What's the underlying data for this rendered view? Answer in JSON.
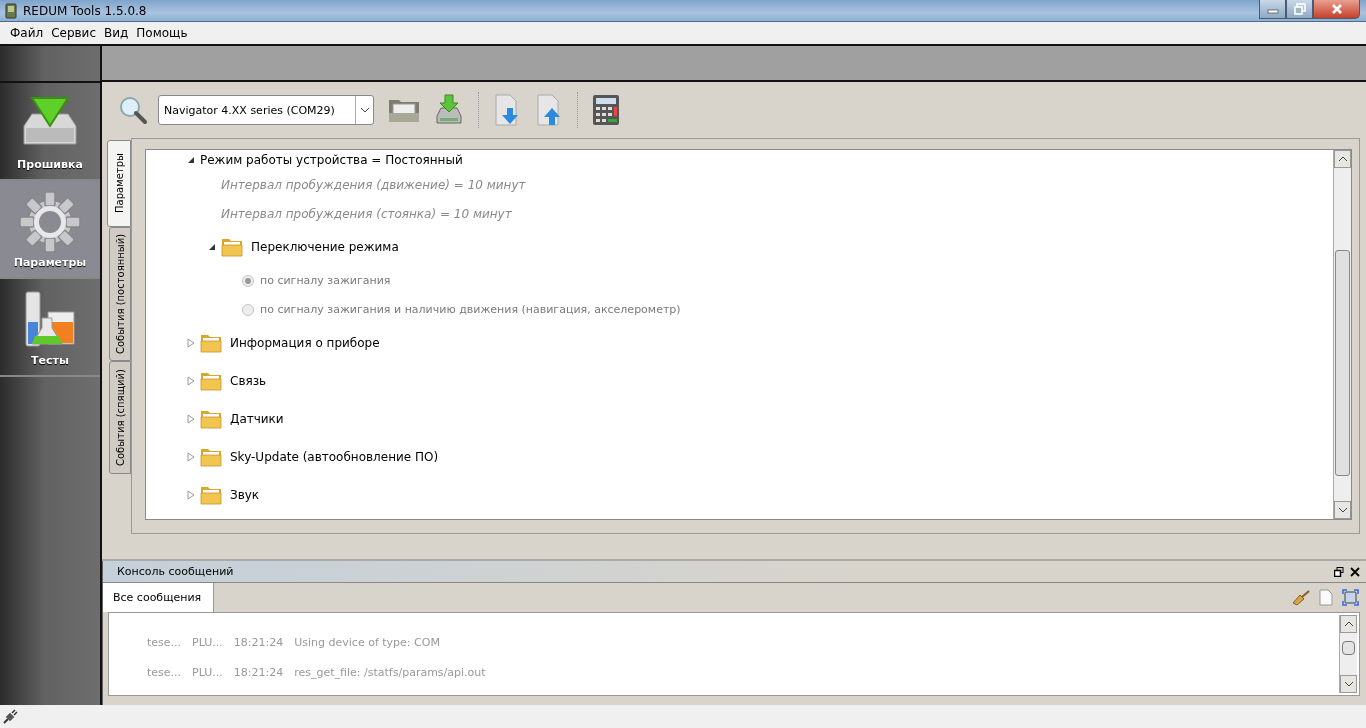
{
  "window": {
    "title": "REDUM Tools 1.5.0.8"
  },
  "menu": [
    "Файл",
    "Сервис",
    "Вид",
    "Помощь"
  ],
  "sidebar": {
    "items": [
      {
        "kind": "firmware",
        "label": "Прошивка",
        "selected": false
      },
      {
        "kind": "settings",
        "label": "Параметры",
        "selected": true
      },
      {
        "kind": "tests",
        "label": "Тесты",
        "selected": false
      }
    ]
  },
  "toolbar": {
    "device_select": {
      "value": "Navigator 4.XX series (COM29)"
    }
  },
  "tabs": [
    {
      "label": "Параметры",
      "selected": true
    },
    {
      "label": "События (постоянный)",
      "selected": false
    },
    {
      "label": "События (спящий)",
      "selected": false
    }
  ],
  "tree": [
    {
      "kind": "setting",
      "label": "Режим работы устройства = Постоянный",
      "expanded": true,
      "children": [
        {
          "kind": "param",
          "label": "Интервал пробуждения (движение) = 10 минут",
          "disabled": true
        },
        {
          "kind": "param",
          "label": "Интервал пробуждения (стоянка) = 10 минут",
          "disabled": true
        },
        {
          "kind": "folder",
          "label": "Переключение режима",
          "expanded": true,
          "children": [
            {
              "kind": "radio",
              "label": "по сигналу зажигания",
              "selected": true,
              "disabled": true
            },
            {
              "kind": "radio",
              "label": "по сигналу зажигания и наличию движения (навигация, акселерометр)",
              "selected": false,
              "disabled": true
            }
          ]
        }
      ]
    },
    {
      "kind": "folder",
      "label": "Информация о приборе",
      "expanded": false
    },
    {
      "kind": "folder",
      "label": "Связь",
      "expanded": false
    },
    {
      "kind": "folder",
      "label": "Датчики",
      "expanded": false
    },
    {
      "kind": "folder",
      "label": "Sky-Update (автообновление ПО)",
      "expanded": false
    },
    {
      "kind": "folder",
      "label": "Звук",
      "expanded": false
    }
  ],
  "console": {
    "title": "Консоль сообщений",
    "tabs": [
      {
        "label": "Все сообщения",
        "selected": true
      }
    ],
    "rows": [
      [
        "tese...",
        "PLU...",
        "18:21:24",
        "Using device of type: COM"
      ],
      [
        "tese...",
        "PLU...",
        "18:21:24",
        "res_get_file: /statfs/params/api.out"
      ]
    ]
  }
}
